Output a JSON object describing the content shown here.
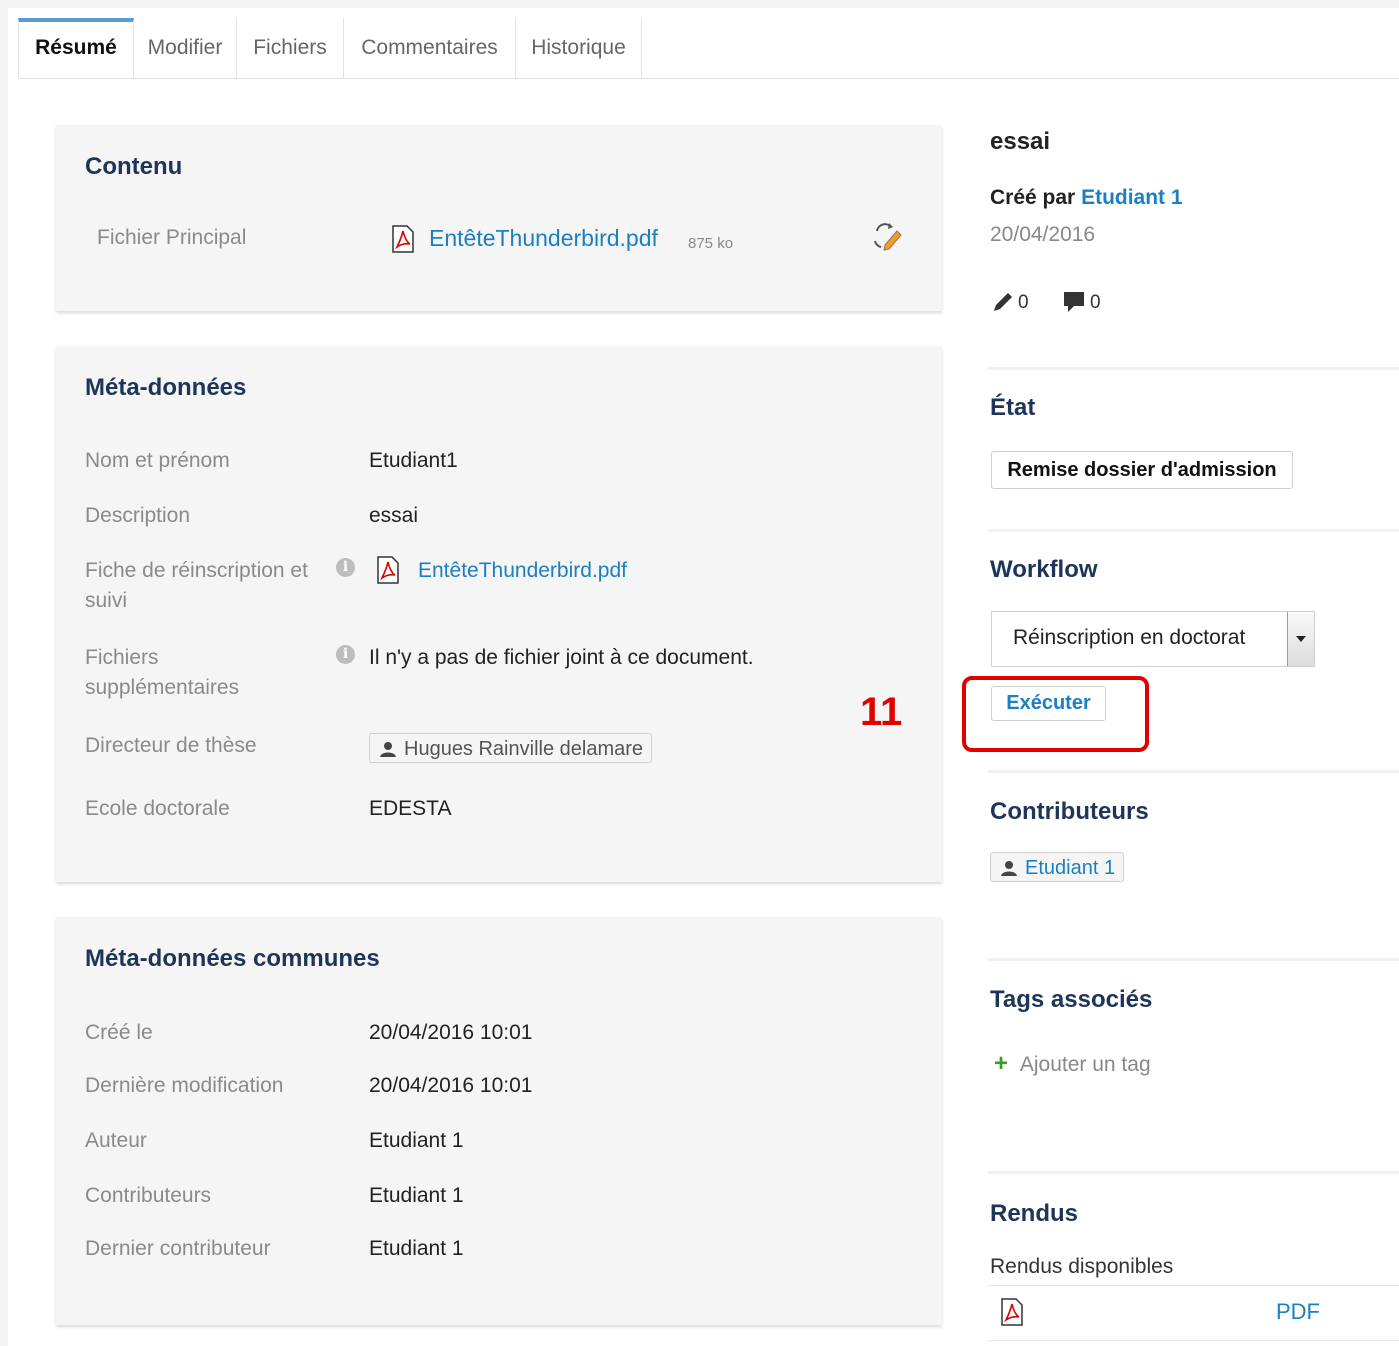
{
  "tabs": [
    {
      "label": "Résumé",
      "active": true
    },
    {
      "label": "Modifier"
    },
    {
      "label": "Fichiers"
    },
    {
      "label": "Commentaires"
    },
    {
      "label": "Historique"
    }
  ],
  "contenu": {
    "title": "Contenu",
    "main_file_label": "Fichier Principal",
    "main_file_name": "EntêteThunderbird.pdf",
    "main_file_size": "875 ko"
  },
  "meta": {
    "title": "Méta-données",
    "rows": [
      {
        "label": "Nom et prénom",
        "value": "Etudiant1"
      },
      {
        "label": "Description",
        "value": "essai"
      },
      {
        "label": "Fiche de réinscription et suivi",
        "value": "EntêteThunderbird.pdf"
      },
      {
        "label": "Fichiers supplémentaires",
        "value": "Il n'y a pas de fichier joint à ce document."
      },
      {
        "label": "Directeur de thèse",
        "value": "Hugues Rainville delamare"
      },
      {
        "label": "Ecole doctorale",
        "value": "EDESTA"
      }
    ]
  },
  "common": {
    "title": "Méta-données communes",
    "rows": [
      {
        "label": "Créé le",
        "value": "20/04/2016 10:01"
      },
      {
        "label": "Dernière modification",
        "value": "20/04/2016 10:01"
      },
      {
        "label": "Auteur",
        "value": "Etudiant 1"
      },
      {
        "label": "Contributeurs",
        "value": "Etudiant 1"
      },
      {
        "label": "Dernier contributeur",
        "value": "Etudiant 1"
      }
    ]
  },
  "side": {
    "doc_title": "essai",
    "created_by_prefix": "Créé par",
    "created_by_user": "Etudiant 1",
    "created_date": "20/04/2016",
    "edit_count": "0",
    "comment_count": "0",
    "state_title": "État",
    "state_value": "Remise dossier d'admission",
    "workflow_title": "Workflow",
    "workflow_selected": "Réinscription en doctorat",
    "execute_label": "Exécuter",
    "annotation_number": "11",
    "contributors_title": "Contributeurs",
    "contributor": "Etudiant 1",
    "tags_title": "Tags associés",
    "add_tag_label": "Ajouter un tag",
    "renditions_title": "Rendus",
    "renditions_subtitle": "Rendus disponibles",
    "rendition_pdf": "PDF"
  },
  "colors": {
    "title": "#1e3559",
    "link": "#1b7fc4",
    "annotation": "#e00000",
    "tab_accent": "#5b9bd5"
  }
}
